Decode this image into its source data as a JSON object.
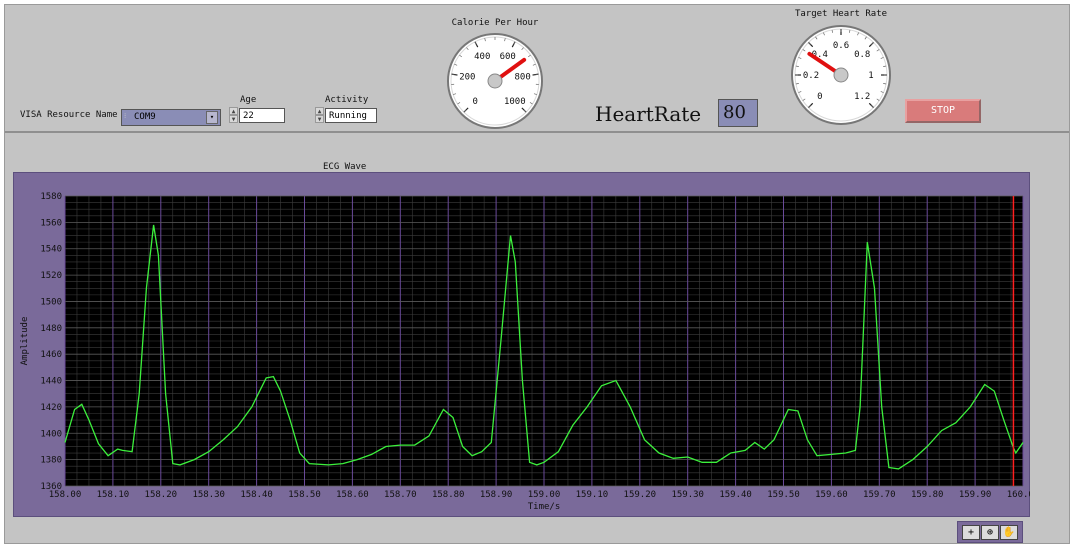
{
  "controls": {
    "visa": {
      "label": "VISA Resource Name",
      "value": "COM9"
    },
    "age": {
      "label": "Age",
      "value": "22"
    },
    "activity": {
      "label": "Activity",
      "value": "Running"
    },
    "heartrate": {
      "label": "HeartRate",
      "value": "80"
    },
    "stop_label": "STOP"
  },
  "gauges": {
    "calorie": {
      "title": "Calorie Per Hour",
      "min": 0,
      "max": 1000,
      "ticks": [
        "0",
        "200",
        "400",
        "600",
        "800",
        "1000"
      ],
      "value": 700,
      "needle_color": "#e01010"
    },
    "target": {
      "title": "Target Heart Rate",
      "min": 0,
      "max": 1.2,
      "ticks": [
        "0",
        "0.2",
        "0.4",
        "0.6",
        "0.8",
        "1",
        "1.2"
      ],
      "value": 0.35,
      "needle_color": "#e01010"
    }
  },
  "colors": {
    "panel": "#c4c4c4",
    "graph_frame": "#7a6a9a",
    "plot_bg": "#000000",
    "trace": "#3cf03c",
    "cursor": "#ff2020"
  },
  "chart_data": {
    "type": "line",
    "title": "ECG Wave",
    "xlabel": "Time/s",
    "ylabel": "Amplitude",
    "xlim": [
      158.0,
      160.0
    ],
    "ylim": [
      1360,
      1580
    ],
    "xticks": [
      "158.00",
      "158.10",
      "158.20",
      "158.30",
      "158.40",
      "158.50",
      "158.60",
      "158.70",
      "158.80",
      "158.90",
      "159.00",
      "159.10",
      "159.20",
      "159.30",
      "159.40",
      "159.50",
      "159.60",
      "159.70",
      "159.80",
      "159.90",
      "160.00"
    ],
    "yticks": [
      "1360",
      "1380",
      "1400",
      "1420",
      "1440",
      "1460",
      "1480",
      "1500",
      "1520",
      "1540",
      "1560",
      "1580"
    ],
    "cursor_x": 159.98,
    "grid": true,
    "series": [
      {
        "x": [
          158.0,
          158.02,
          158.035,
          158.05,
          158.07,
          158.09,
          158.11,
          158.12,
          158.14,
          158.155,
          158.17,
          158.185,
          158.195,
          158.21,
          158.225,
          158.24,
          158.27,
          158.3,
          158.33,
          158.36,
          158.39,
          158.42,
          158.435,
          158.45,
          158.47,
          158.49,
          158.51,
          158.55,
          158.58,
          158.61,
          158.64,
          158.67,
          158.7,
          158.73,
          158.76,
          158.79,
          158.81,
          158.83,
          158.85,
          158.87,
          158.89,
          158.91,
          158.93,
          158.94,
          158.955,
          158.97,
          158.985,
          159.0,
          159.03,
          159.06,
          159.09,
          159.12,
          159.15,
          159.18,
          159.21,
          159.24,
          159.27,
          159.3,
          159.33,
          159.36,
          159.39,
          159.42,
          159.44,
          159.46,
          159.48,
          159.51,
          159.53,
          159.55,
          159.57,
          159.6,
          159.63,
          159.65,
          159.66,
          159.675,
          159.69,
          159.705,
          159.72,
          159.74,
          159.77,
          159.8,
          159.83,
          159.86,
          159.89,
          159.92,
          159.94,
          159.96,
          159.98,
          159.985,
          160.0
        ],
        "values": [
          1393,
          1418,
          1422,
          1410,
          1392,
          1383,
          1388,
          1387,
          1386,
          1430,
          1510,
          1558,
          1535,
          1430,
          1377,
          1376,
          1380,
          1386,
          1395,
          1405,
          1420,
          1442,
          1443,
          1432,
          1410,
          1385,
          1377,
          1376,
          1377,
          1380,
          1384,
          1390,
          1391,
          1391,
          1398,
          1418,
          1412,
          1390,
          1383,
          1386,
          1393,
          1470,
          1550,
          1530,
          1440,
          1378,
          1376,
          1378,
          1386,
          1406,
          1420,
          1436,
          1440,
          1420,
          1395,
          1385,
          1381,
          1382,
          1378,
          1378,
          1385,
          1387,
          1393,
          1388,
          1395,
          1418,
          1417,
          1395,
          1383,
          1384,
          1385,
          1387,
          1420,
          1545,
          1510,
          1420,
          1374,
          1373,
          1380,
          1390,
          1402,
          1408,
          1420,
          1437,
          1432,
          1410,
          1389,
          1385,
          1393
        ]
      }
    ]
  }
}
